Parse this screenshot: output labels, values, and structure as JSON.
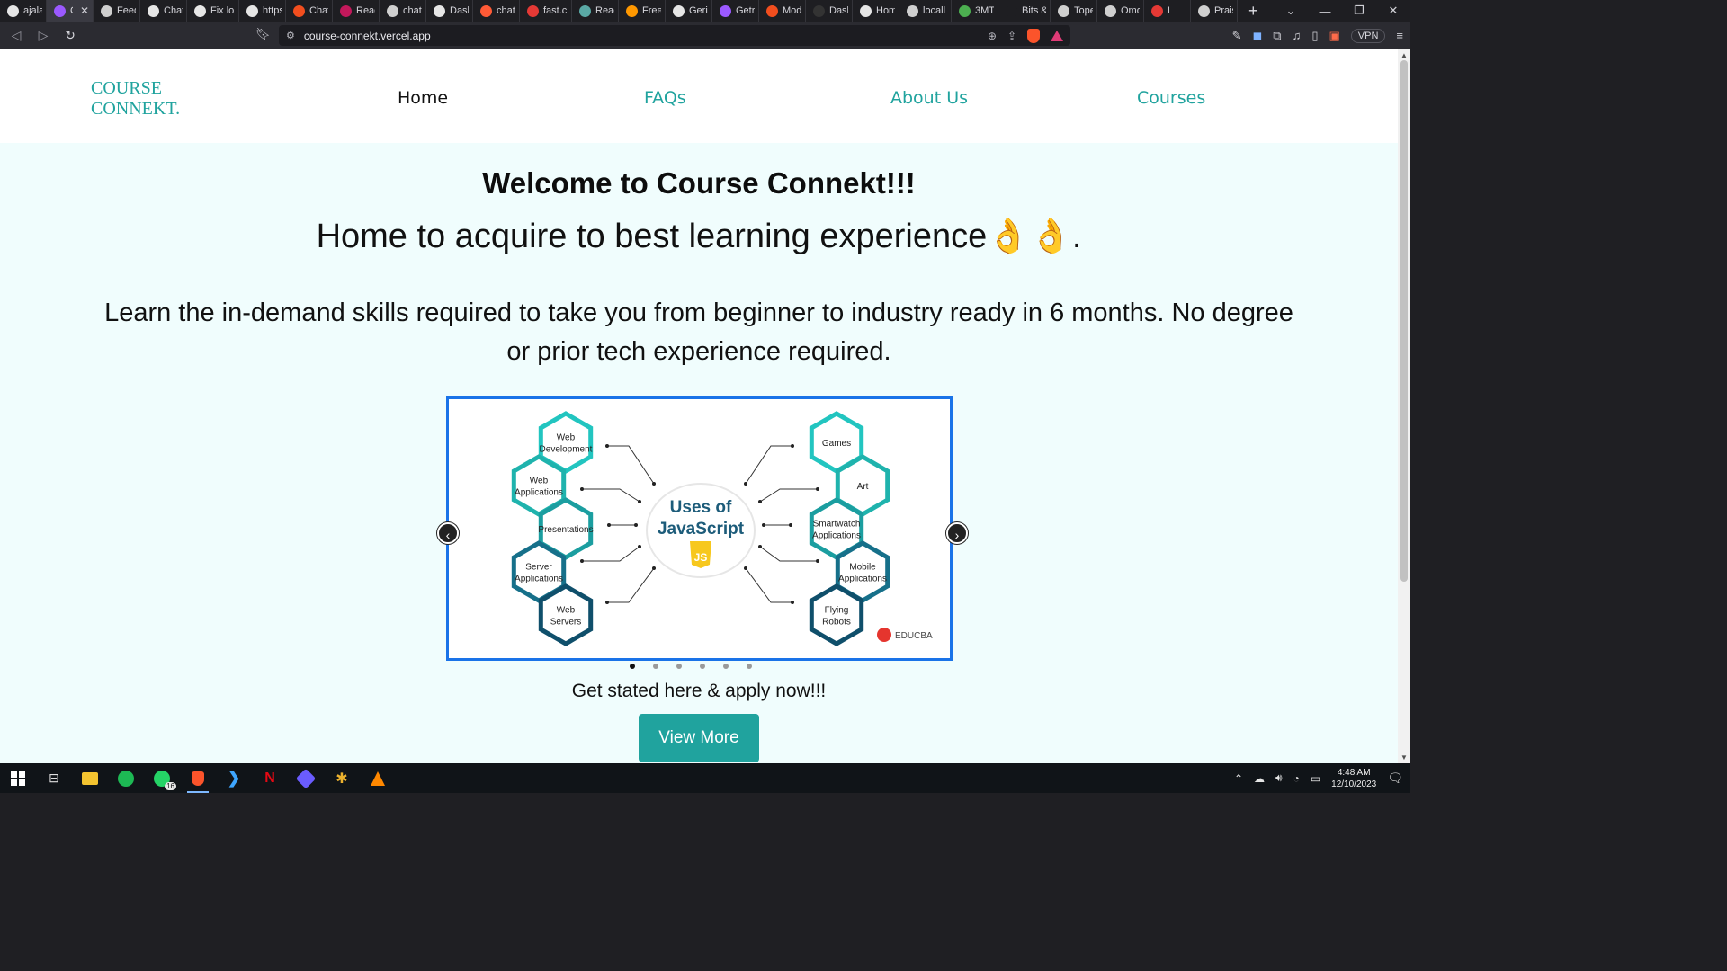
{
  "browser": {
    "tabs": [
      {
        "label": "ajala",
        "color": "#e6e6e6"
      },
      {
        "label": "C",
        "color": "#9b59ff",
        "active": true
      },
      {
        "label": "Feed",
        "color": "#cfcfcf"
      },
      {
        "label": "Chat",
        "color": "#e6e6e6"
      },
      {
        "label": "Fix lo",
        "color": "#e6e6e6"
      },
      {
        "label": "https",
        "color": "#e6e6e6"
      },
      {
        "label": "Chat",
        "color": "#f24e1e"
      },
      {
        "label": "Reac",
        "color": "#c2185b"
      },
      {
        "label": "chat",
        "color": "#cfcfcf"
      },
      {
        "label": "Dash",
        "color": "#e6e6e6"
      },
      {
        "label": "chat",
        "color": "#ff5a36"
      },
      {
        "label": "fast.c",
        "color": "#e53935"
      },
      {
        "label": "Reac",
        "color": "#5aa9a5"
      },
      {
        "label": "Free",
        "color": "#ff9800"
      },
      {
        "label": "Geric",
        "color": "#e6e6e6"
      },
      {
        "label": "Getri",
        "color": "#9b59ff"
      },
      {
        "label": "Mod",
        "color": "#f24e1e"
      },
      {
        "label": "Dash",
        "color": "#333333"
      },
      {
        "label": "Hom",
        "color": "#e6e6e6"
      },
      {
        "label": "locall",
        "color": "#cfcfcf"
      },
      {
        "label": "3MT",
        "color": "#4caf50"
      },
      {
        "label": "Bits &",
        "color": "#1e1e22"
      },
      {
        "label": "Tope",
        "color": "#cfcfcf"
      },
      {
        "label": "Omo",
        "color": "#cfcfcf"
      },
      {
        "label": "L",
        "color": "#e53935"
      },
      {
        "label": "Prais",
        "color": "#cfcfcf"
      }
    ],
    "url": "course-connekt.vercel.app",
    "vpn_label": "VPN"
  },
  "site": {
    "logo_line1": "COURSE",
    "logo_line2": "CONNEKT.",
    "nav": {
      "home": "Home",
      "faqs": "FAQs",
      "about": "About Us",
      "courses": "Courses"
    },
    "hero": {
      "title": "Welcome to Course Connekt!!!",
      "subtitle": "Home to acquire to best learning experience👌👌.",
      "description": "Learn the in-demand skills required to take you from beginner to industry ready in 6 months. No degree or prior tech experience required."
    },
    "carousel": {
      "slide_count": 6,
      "active_index": 0,
      "title_line1": "Uses of",
      "title_line2": "JavaScript",
      "js_badge": "JS",
      "brand": "EDUCBA",
      "left_hexes": [
        [
          "Web",
          "Development"
        ],
        [
          "Web",
          "Applications"
        ],
        [
          "Presentations"
        ],
        [
          "Server",
          "Applications"
        ],
        [
          "Web",
          "Servers"
        ]
      ],
      "right_hexes": [
        [
          "Games"
        ],
        [
          "Art"
        ],
        [
          "Smartwatch",
          "Applications"
        ],
        [
          "Mobile",
          "Applications"
        ],
        [
          "Flying",
          "Robots"
        ]
      ]
    },
    "cta": {
      "text": "Get stated here & apply now!!!",
      "button": "View More"
    }
  },
  "taskbar": {
    "whatsapp_badge": "16",
    "time": "4:48 AM",
    "date": "12/10/2023"
  }
}
